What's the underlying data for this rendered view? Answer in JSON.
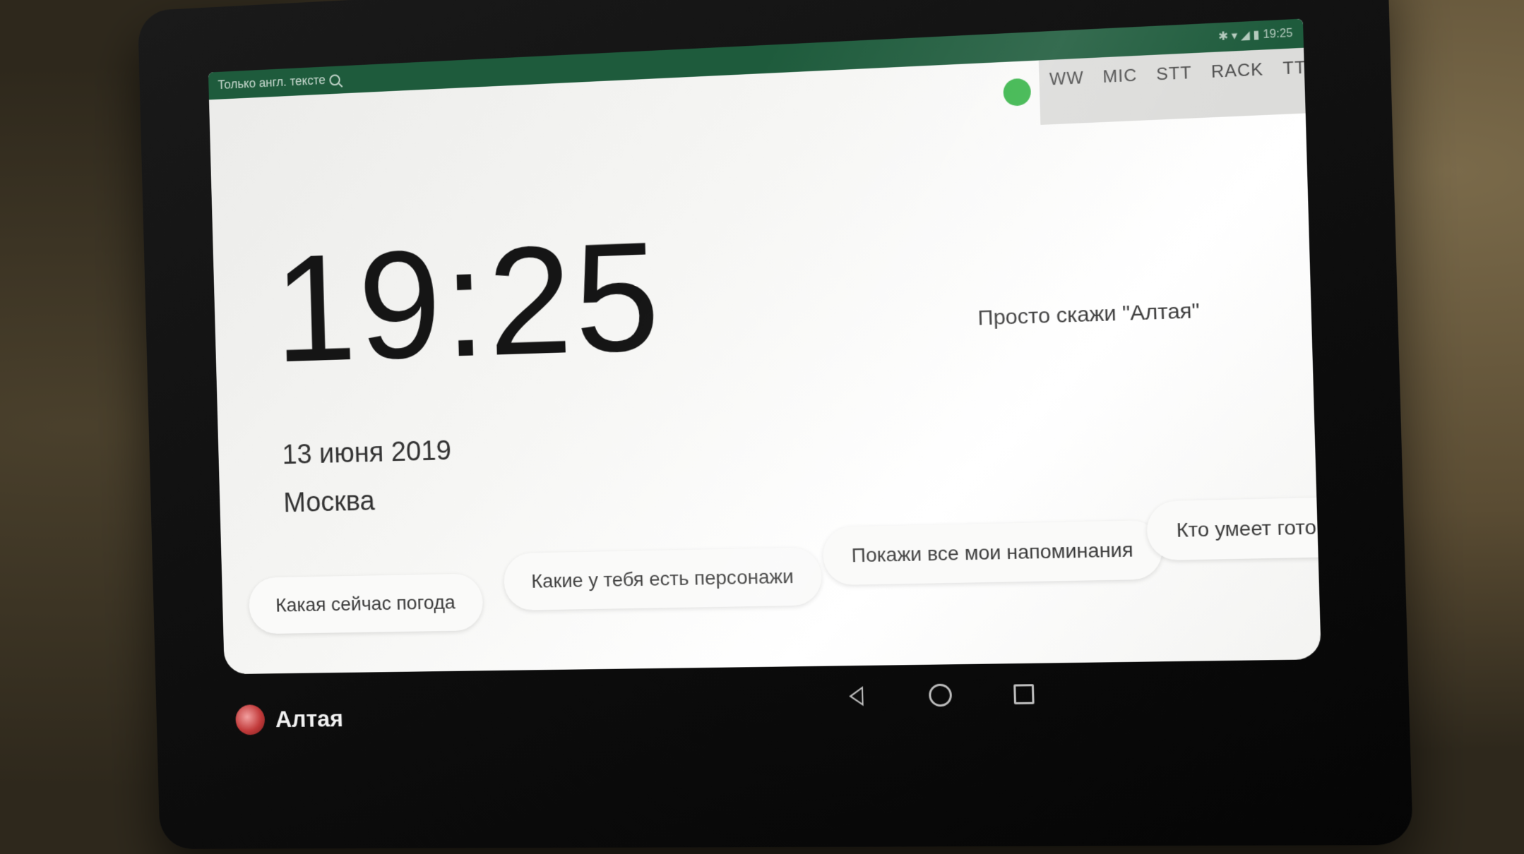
{
  "statusbar": {
    "search_hint": "Только англ. тексте",
    "system_icons": "✱ ▾ ◢ ▮ 19:25"
  },
  "indicators": {
    "labels": [
      "WW",
      "MIC",
      "STT",
      "RACK",
      "TTS"
    ],
    "sublabels": [
      "",
      "",
      "",
      "",
      ""
    ],
    "status_color": "#39b54a"
  },
  "main": {
    "ghost_title": "",
    "time": "19:25",
    "date": "13 июня 2019",
    "city": "Москва",
    "wake_hint": "Просто скажи \"Алтая\""
  },
  "suggestions": [
    "Какая сейчас погода",
    "Какие у тебя есть персонажи",
    "Покажи все мои напоминания",
    "Кто умеет готови"
  ],
  "brand": {
    "name": "Алтая",
    "logo": "altaya-logo-icon"
  },
  "colors": {
    "statusbar": "#1e5b3c",
    "accent_green": "#39b54a"
  }
}
